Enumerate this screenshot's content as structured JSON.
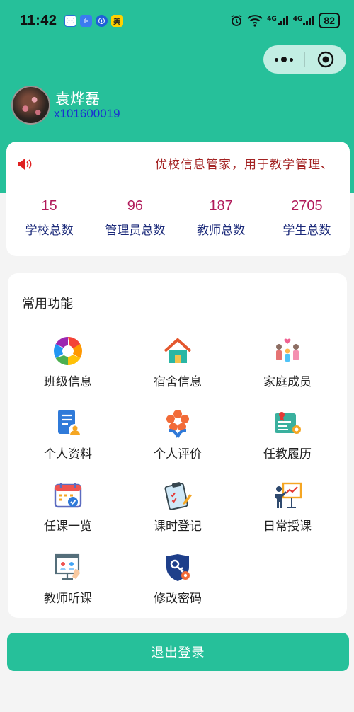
{
  "status_bar": {
    "time": "11:42",
    "app_badge_label": "美",
    "network_1": "4G",
    "network_2": "4G",
    "battery": "82"
  },
  "user": {
    "name": "袁烨磊",
    "id": "x101600019"
  },
  "notice": {
    "text": "优校信息管家，用于教学管理、"
  },
  "stats": [
    {
      "value": "15",
      "label": "学校总数"
    },
    {
      "value": "96",
      "label": "管理员总数"
    },
    {
      "value": "187",
      "label": "教师总数"
    },
    {
      "value": "2705",
      "label": "学生总数"
    }
  ],
  "functions": {
    "title": "常用功能",
    "items": [
      {
        "label": "班级信息",
        "icon": "aperture-icon"
      },
      {
        "label": "宿舍信息",
        "icon": "house-icon"
      },
      {
        "label": "家庭成员",
        "icon": "family-icon"
      },
      {
        "label": "个人资料",
        "icon": "profile-doc-icon"
      },
      {
        "label": "个人评价",
        "icon": "flower-icon"
      },
      {
        "label": "任教履历",
        "icon": "certificate-icon"
      },
      {
        "label": "任课一览",
        "icon": "calendar-check-icon"
      },
      {
        "label": "课时登记",
        "icon": "clipboard-icon"
      },
      {
        "label": "日常授课",
        "icon": "teacher-board-icon"
      },
      {
        "label": "教师听课",
        "icon": "screen-lecture-icon"
      },
      {
        "label": "修改密码",
        "icon": "key-shield-icon"
      }
    ]
  },
  "logout_label": "退出登录",
  "colors": {
    "primary": "#26c09a",
    "stat_value": "#b11a5a",
    "stat_label": "#1b2a7a",
    "notice_text": "#a32222",
    "user_id": "#1a2fd1"
  }
}
